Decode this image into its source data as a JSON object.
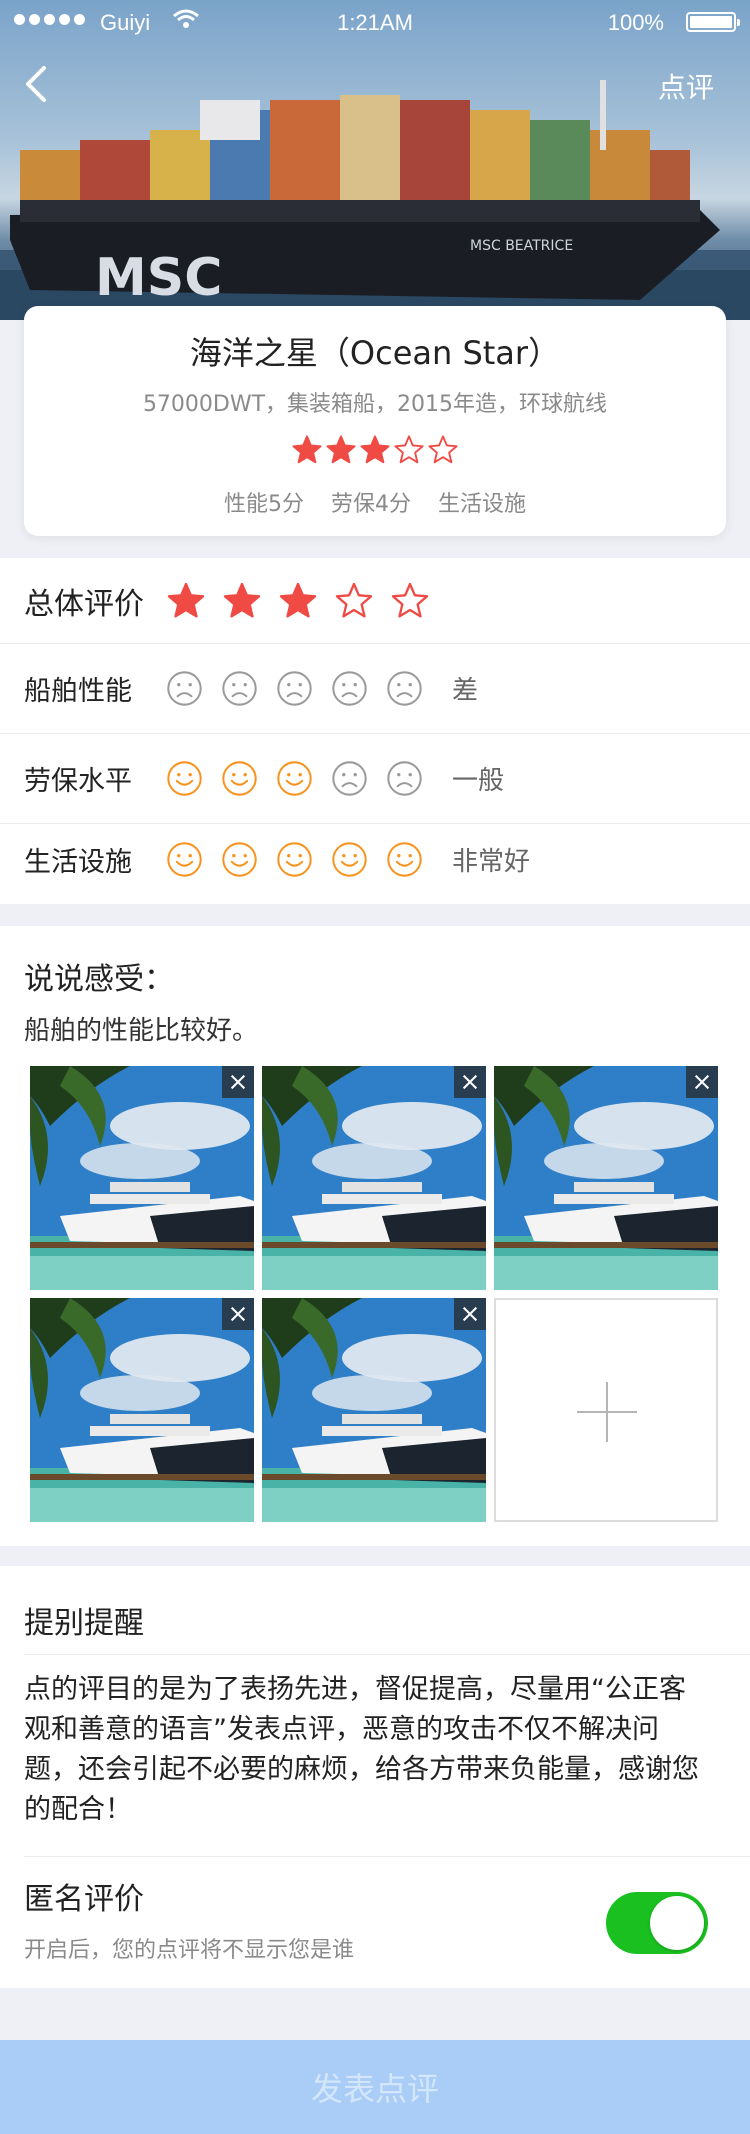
{
  "status_bar": {
    "carrier": "Guiyi",
    "time": "1:21AM",
    "battery": "100%"
  },
  "nav": {
    "back_icon": "chevron-left-icon",
    "review_label": "点评"
  },
  "ship": {
    "name": "海洋之星（Ocean Star）",
    "desc": "57000DWT，集装箱船，2015年造，环球航线",
    "rating": 3,
    "rating_max": 5,
    "scores": [
      "性能5分",
      "劳保4分",
      "生活设施"
    ]
  },
  "ratings": {
    "overall": {
      "label": "总体评价",
      "value": 3,
      "max": 5
    },
    "items": [
      {
        "label": "船舶性能",
        "happy": 0,
        "max": 5,
        "verdict": "差"
      },
      {
        "label": "劳保水平",
        "happy": 3,
        "max": 5,
        "verdict": "一般"
      },
      {
        "label": "生活设施",
        "happy": 5,
        "max": 5,
        "verdict": "非常好"
      }
    ]
  },
  "feel": {
    "title": "说说感受：",
    "text": "船舶的性能比较好。",
    "photo_count": 5
  },
  "remind": {
    "title": "提别提醒",
    "text": "点的评目的是为了表扬先进，督促提高，尽量用“公正客观和善意的语言”发表点评，恶意的攻击不仅不解决问题，还会引起不必要的麻烦，给各方带来负能量，感谢您的配合！"
  },
  "anonymous": {
    "title": "匿名评价",
    "hint": "开启后，您的点评将不显示您是谁",
    "enabled": true
  },
  "submit": {
    "label": "发表点评"
  },
  "colors": {
    "star": "#f04a45",
    "happy": "#f7931e",
    "sad": "#9a9a9a",
    "toggle": "#19c01f",
    "submit": "#a9cdf7"
  }
}
